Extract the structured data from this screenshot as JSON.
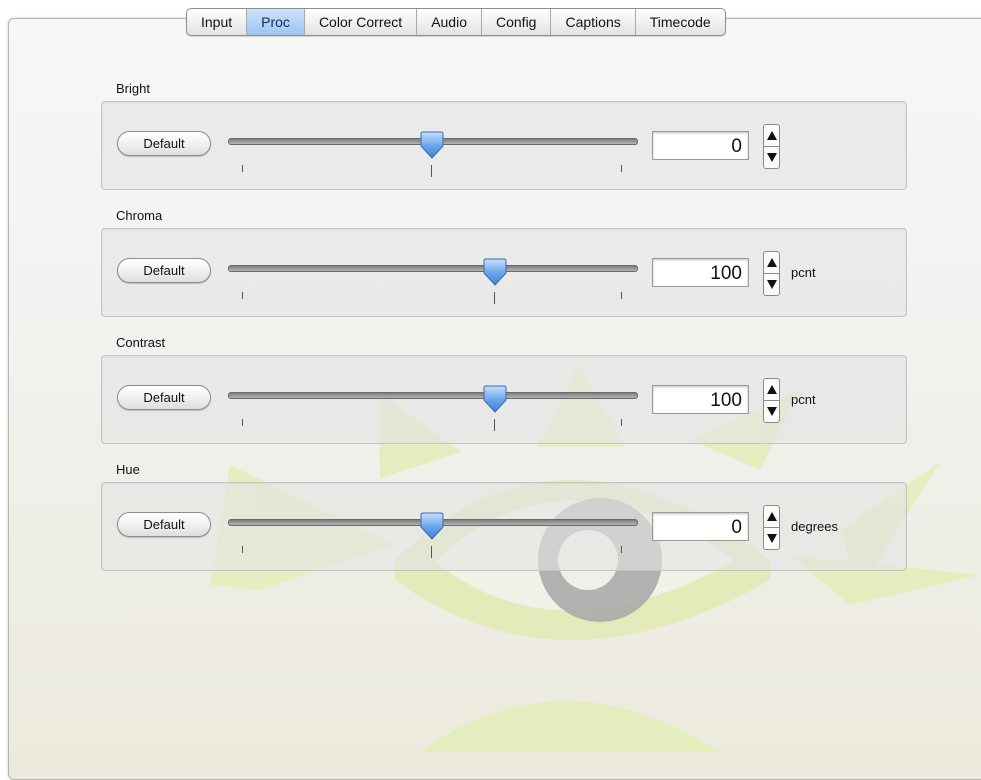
{
  "tabs": [
    {
      "label": "Input",
      "active": false
    },
    {
      "label": "Proc",
      "active": true
    },
    {
      "label": "Color Correct",
      "active": false
    },
    {
      "label": "Audio",
      "active": false
    },
    {
      "label": "Config",
      "active": false
    },
    {
      "label": "Captions",
      "active": false
    },
    {
      "label": "Timecode",
      "active": false
    }
  ],
  "controls": [
    {
      "title": "Bright",
      "button": "Default",
      "value": "0",
      "unit": "",
      "slider_position": 0.5
    },
    {
      "title": "Chroma",
      "button": "Default",
      "value": "100",
      "unit": "pcnt",
      "slider_position": 0.65
    },
    {
      "title": "Contrast",
      "button": "Default",
      "value": "100",
      "unit": "pcnt",
      "slider_position": 0.65
    },
    {
      "title": "Hue",
      "button": "Default",
      "value": "0",
      "unit": "degrees",
      "slider_position": 0.5
    }
  ],
  "icons": {
    "stepper_up": "up-arrow-icon",
    "stepper_down": "down-arrow-icon",
    "slider_thumb": "slider-thumb-icon",
    "background": "eye-logo"
  },
  "colors": {
    "active_tab": "#9cc4ef",
    "thumb": "#5f9fe8",
    "watermark_green": "#dbe7ad",
    "watermark_gray": "#a9a9a9"
  }
}
